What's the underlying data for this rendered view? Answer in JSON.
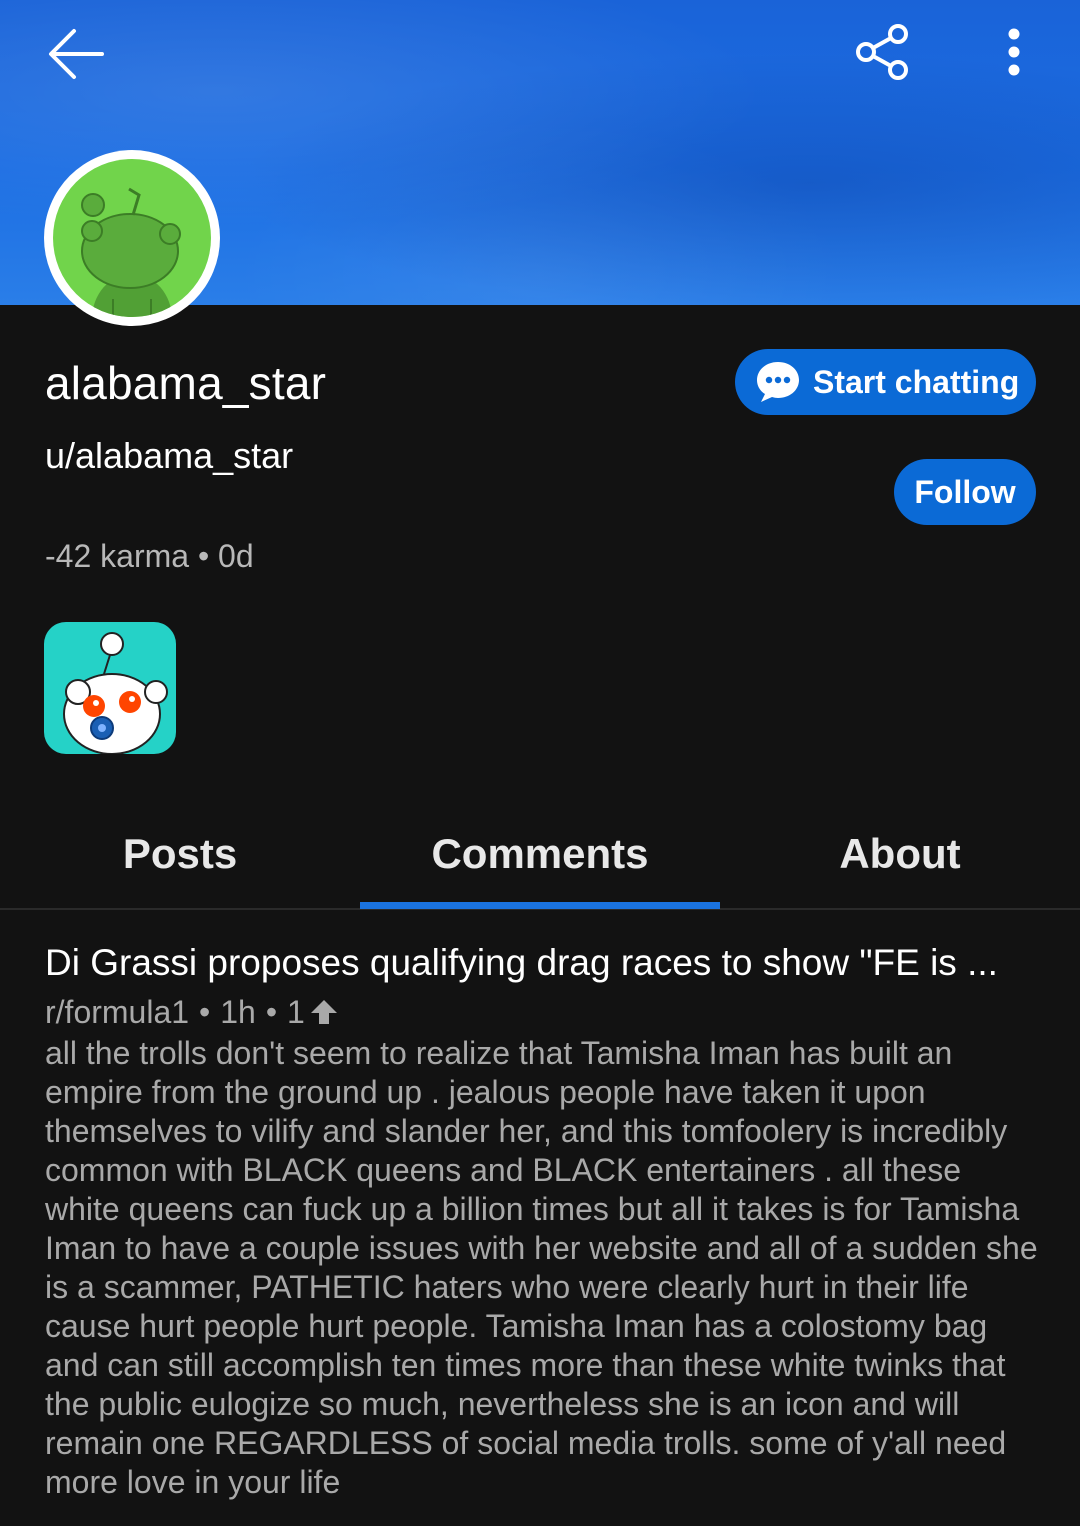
{
  "header": {
    "back_icon": "arrow-left-icon",
    "share_icon": "share-icon",
    "more_icon": "more-vertical-icon",
    "banner_color": "#1c6ee3"
  },
  "profile": {
    "display_name": "alabama_star",
    "username": "u/alabama_star",
    "karma": "-42 karma",
    "separator": "•",
    "age": "0d",
    "avatar_color": "#71d44b"
  },
  "actions": {
    "chat_label": "Start chatting",
    "chat_icon": "chat-bubble-icon",
    "follow_label": "Follow",
    "accent": "#0b6ad6"
  },
  "tabs": [
    {
      "label": "Posts",
      "active": false
    },
    {
      "label": "Comments",
      "active": true
    },
    {
      "label": "About",
      "active": false
    }
  ],
  "comments": [
    {
      "post_title": "Di Grassi proposes qualifying drag races to show \"FE is ...",
      "subreddit": "r/formula1",
      "time": "1h",
      "score": "1",
      "score_icon": "upvote-arrow-icon",
      "body": "all the trolls don't seem to realize that Tamisha Iman has built an empire from the ground up . jealous people have taken it upon themselves to vilify and slander her, and this tomfoolery is incredibly common with BLACK queens and BLACK entertainers . all these white queens can fuck up a billion times but all it takes is for Tamisha Iman to have a couple issues with her website and all of a sudden she is a scammer, PATHETIC haters who were clearly hurt in their life cause hurt people hurt people. Tamisha Iman has a colostomy bag and can still accomplish ten times more than these white twinks that the public eulogize so much, nevertheless she is an icon and will remain one REGARDLESS of social media trolls. some of y'all need more love in your life"
    }
  ]
}
